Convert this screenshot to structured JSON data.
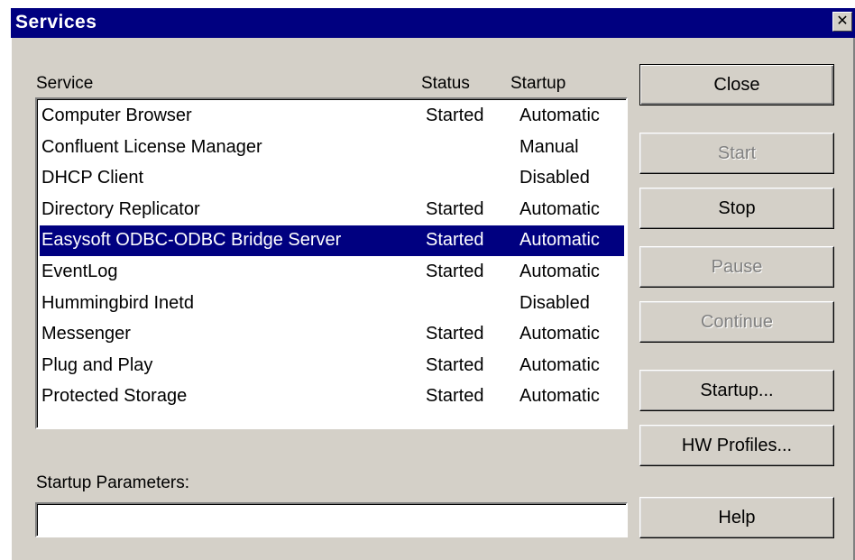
{
  "window": {
    "title": "Services",
    "close_glyph": "✕"
  },
  "columns": {
    "service": "Service",
    "status": "Status",
    "startup": "Startup"
  },
  "services": [
    {
      "name": "Computer Browser",
      "status": "Started",
      "startup": "Automatic"
    },
    {
      "name": "Confluent License Manager",
      "status": "",
      "startup": "Manual"
    },
    {
      "name": "DHCP Client",
      "status": "",
      "startup": "Disabled"
    },
    {
      "name": "Directory Replicator",
      "status": "Started",
      "startup": "Automatic"
    },
    {
      "name": "Easysoft ODBC-ODBC Bridge Server",
      "status": "Started",
      "startup": "Automatic"
    },
    {
      "name": "EventLog",
      "status": "Started",
      "startup": "Automatic"
    },
    {
      "name": "Hummingbird Inetd",
      "status": "",
      "startup": "Disabled"
    },
    {
      "name": "Messenger",
      "status": "Started",
      "startup": "Automatic"
    },
    {
      "name": "Plug and Play",
      "status": "Started",
      "startup": "Automatic"
    },
    {
      "name": "Protected Storage",
      "status": "Started",
      "startup": "Automatic"
    }
  ],
  "selected_index": 4,
  "buttons": {
    "close": "Close",
    "start": "Start",
    "stop": "Stop",
    "pause": "Pause",
    "continue": "Continue",
    "startup": "Startup...",
    "hw_profiles": "HW Profiles...",
    "help": "Help"
  },
  "startup_parameters": {
    "label": "Startup Parameters:",
    "value": ""
  },
  "colors": {
    "face": "#d4d0c8",
    "titlebar": "#000080",
    "selection": "#000080",
    "disabled_text": "#808080"
  }
}
